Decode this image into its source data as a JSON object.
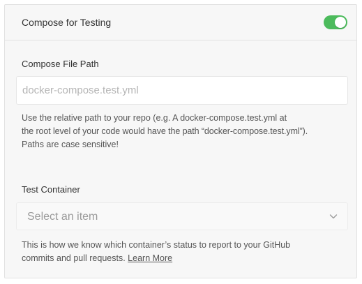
{
  "header": {
    "title": "Compose for Testing",
    "toggle_enabled": true,
    "toggle_color": "#4cbb5c"
  },
  "compose_file": {
    "label": "Compose File Path",
    "value": "",
    "placeholder": "docker-compose.test.yml",
    "help_line1": "Use the relative path to your repo (e.g. A docker-compose.test.yml at",
    "help_line2": "the root level of your code would have the path “docker-compose.test.yml”).",
    "help_line3": "Paths are case sensitive!"
  },
  "test_container": {
    "label": "Test Container",
    "selected": "Select an item",
    "help_line1": "This is how we know which container’s status to report to your GitHub",
    "help_line2_prefix": "commits and pull requests.",
    "learn_more": "Learn More",
    "chevron_icon": "chevron-down-icon"
  }
}
